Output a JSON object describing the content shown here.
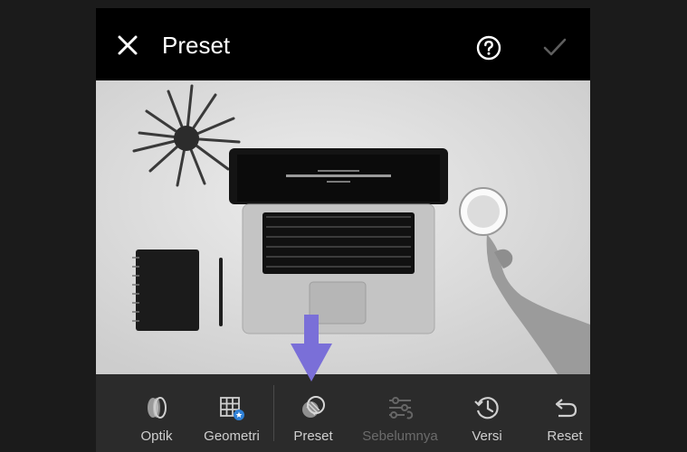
{
  "header": {
    "title": "Preset"
  },
  "toolbar": {
    "items": [
      {
        "label": "Optik",
        "icon": "optik-icon",
        "enabled": true
      },
      {
        "label": "Geometri",
        "icon": "geometri-icon",
        "enabled": true
      },
      {
        "label": "Preset",
        "icon": "preset-icon",
        "enabled": true
      },
      {
        "label": "Sebelumnya",
        "icon": "sliders-icon",
        "enabled": false
      },
      {
        "label": "Versi",
        "icon": "history-clock-icon",
        "enabled": true
      },
      {
        "label": "Reset",
        "icon": "undo-arrow-icon",
        "enabled": true
      }
    ]
  },
  "colors": {
    "background": "#1b1b1b",
    "topbar": "#000000",
    "toolbar": "#2b2b2b",
    "label": "#cfcfcf",
    "disabled_label": "#6b6b6b",
    "annotation_arrow": "#7a6fd8"
  }
}
